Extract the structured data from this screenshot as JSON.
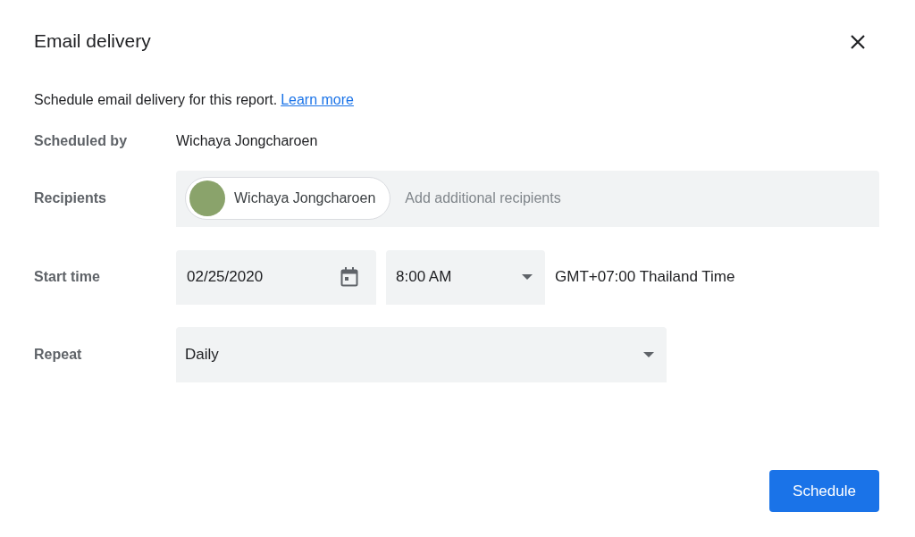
{
  "dialog": {
    "title": "Email delivery"
  },
  "description": {
    "text": "Schedule email delivery for this report.",
    "link": "Learn more"
  },
  "scheduled_by": {
    "label": "Scheduled by",
    "value": "Wichaya Jongcharoen"
  },
  "recipients": {
    "label": "Recipients",
    "chips": [
      {
        "name": "Wichaya Jongcharoen"
      }
    ],
    "placeholder": "Add additional recipients"
  },
  "start_time": {
    "label": "Start time",
    "date": "02/25/2020",
    "time": "8:00 AM",
    "timezone": "GMT+07:00 Thailand Time"
  },
  "repeat": {
    "label": "Repeat",
    "value": "Daily"
  },
  "buttons": [
    {
      "label": "Schedule"
    }
  ]
}
